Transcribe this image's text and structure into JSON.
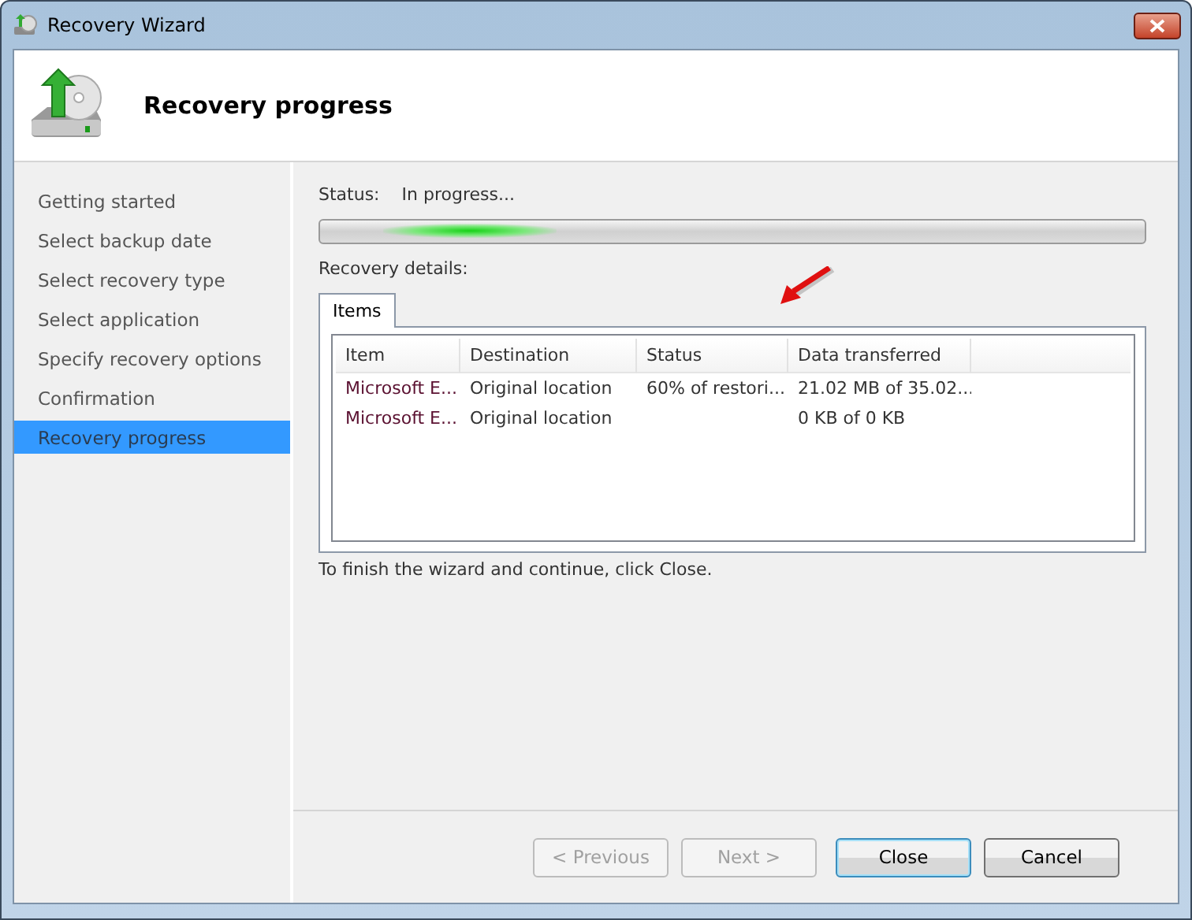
{
  "window": {
    "title": "Recovery Wizard"
  },
  "header": {
    "title": "Recovery progress"
  },
  "sidebar": {
    "items": [
      {
        "label": "Getting started",
        "selected": false
      },
      {
        "label": "Select backup date",
        "selected": false
      },
      {
        "label": "Select recovery type",
        "selected": false
      },
      {
        "label": "Select application",
        "selected": false
      },
      {
        "label": "Specify recovery options",
        "selected": false
      },
      {
        "label": "Confirmation",
        "selected": false
      },
      {
        "label": "Recovery progress",
        "selected": true
      }
    ]
  },
  "status": {
    "label": "Status:",
    "value": "In progress..."
  },
  "progress": {
    "indeterminate": true
  },
  "details_label": "Recovery details:",
  "tabs": [
    {
      "label": "Items",
      "selected": true
    }
  ],
  "table": {
    "columns": [
      "Item",
      "Destination",
      "Status",
      "Data transferred"
    ],
    "rows": [
      [
        "Microsoft E...",
        "Original location",
        "60% of restori...",
        "21.02 MB of 35.02..."
      ],
      [
        "Microsoft E...",
        "Original location",
        "",
        "0 KB of 0 KB"
      ]
    ]
  },
  "hint": "To finish the wizard and continue, click Close.",
  "buttons": [
    {
      "label": "< Previous",
      "disabled": true,
      "default": false
    },
    {
      "label": "Next >",
      "disabled": true,
      "default": false
    },
    {
      "label": "Close",
      "disabled": false,
      "default": true
    },
    {
      "label": "Cancel",
      "disabled": false,
      "default": false
    }
  ]
}
